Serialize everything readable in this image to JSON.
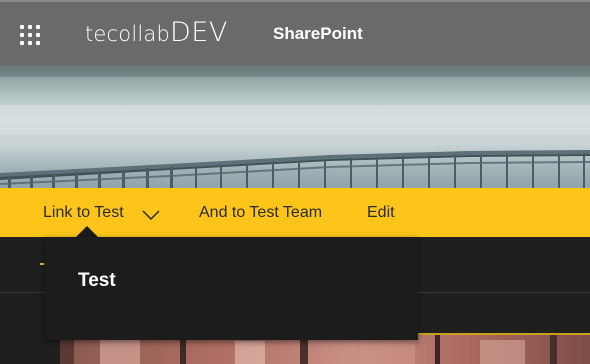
{
  "suite_bar": {
    "tenant_name": "tecollab",
    "tenant_suffix": "DEV",
    "app_name": "SharePoint",
    "waffle_icon": "app-launcher-icon"
  },
  "navigation": {
    "items": [
      {
        "label": "Link to Test",
        "has_dropdown": true,
        "expanded": true
      },
      {
        "label": "And to Test Team",
        "has_dropdown": false
      },
      {
        "label": "Edit",
        "has_dropdown": false
      }
    ]
  },
  "flyout": {
    "items": [
      {
        "label": "Test"
      }
    ]
  },
  "colors": {
    "suite_bar_bg": "#6a6a6a",
    "nav_bar_bg": "#fdc51a",
    "flyout_bg": "#1c1c1c",
    "page_bg": "#1f1f1f"
  }
}
